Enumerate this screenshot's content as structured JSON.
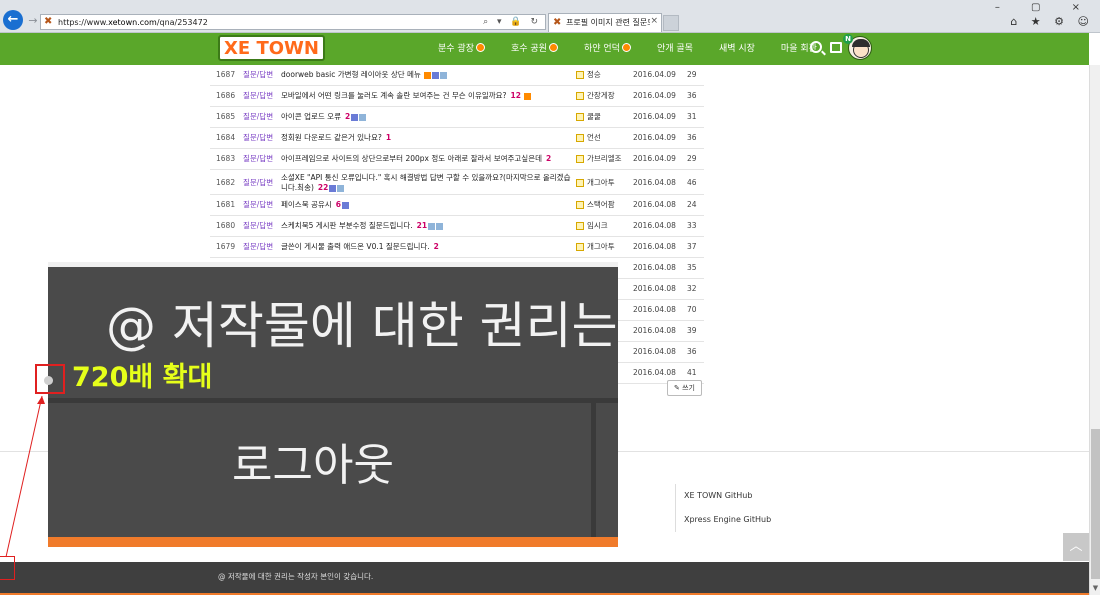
{
  "browser": {
    "url_prefix": "https://www.",
    "url_host": "xetown.com",
    "url_path": "/qna/253472",
    "url_controls": "⌕ ▾ 🔒 ↻",
    "tab_title": "프로필 이미지 관련 질문드...",
    "tab_close": "×",
    "back": "←",
    "forward": "→",
    "window_controls": "– ▢ ×",
    "toolbar_icons": "⌂ ★ ⚙ ☺",
    "site_icon": "✖"
  },
  "site": {
    "logo": "XE TOWN",
    "menu": [
      {
        "label": "분수 광장",
        "badge": true
      },
      {
        "label": "호수 공원",
        "badge": true
      },
      {
        "label": "하얀 언덕",
        "badge": true
      },
      {
        "label": "안개 골목",
        "badge": false
      },
      {
        "label": "새벽 시장",
        "badge": false
      },
      {
        "label": "마을 회관",
        "badge": false
      }
    ],
    "avatar_badge": "N"
  },
  "board": {
    "rows": [
      {
        "no": "1687",
        "cat": "질문/답변",
        "title": "doorweb basic 가변형 레이아웃 상단 메뉴",
        "comments": "",
        "icons": [
          "a",
          "b",
          "c"
        ],
        "author": "정승",
        "date": "2016.04.09",
        "views": "29"
      },
      {
        "no": "1686",
        "cat": "질문/답변",
        "title": "모바일에서 어떤 링크를 눌러도 계속 솔란 보여주는 건 무슨 이유일까요?",
        "comments": "12",
        "icons": [
          "a"
        ],
        "author": "간장게장",
        "date": "2016.04.09",
        "views": "36"
      },
      {
        "no": "1685",
        "cat": "질문/답변",
        "title": "아이콘 업로드 오류",
        "comments": "2",
        "icons": [
          "b",
          "c"
        ],
        "author": "쿨쿨",
        "date": "2016.04.09",
        "views": "31"
      },
      {
        "no": "1684",
        "cat": "질문/답변",
        "title": "정회원 다운로드 같은거 있나요?",
        "comments": "1",
        "icons": [],
        "author": "언선",
        "date": "2016.04.09",
        "views": "36"
      },
      {
        "no": "1683",
        "cat": "질문/답변",
        "title": "아이프레임으로 사이트의 상단으로부터 200px 정도 아래로 잘라서 보여주고싶은데",
        "comments": "2",
        "icons": [],
        "author": "가브리엘조",
        "date": "2016.04.09",
        "views": "29"
      },
      {
        "no": "1682",
        "cat": "질문/답변",
        "title": "소셜XE \"API 통신 오류입니다.\" 혹시 해결방법 답변 구할 수 있을까요?(마지막으로 올리겠습니다.최송)",
        "comments": "22",
        "icons": [
          "b",
          "c"
        ],
        "author": "개그아투",
        "date": "2016.04.08",
        "views": "46",
        "tall": true
      },
      {
        "no": "1681",
        "cat": "질문/답변",
        "title": "페이스북 공유시",
        "comments": "6",
        "icons": [
          "b"
        ],
        "author": "스택어팜",
        "date": "2016.04.08",
        "views": "24"
      },
      {
        "no": "1680",
        "cat": "질문/답변",
        "title": "스케치북5 게시판 부분수정 질문드립니다.",
        "comments": "21",
        "icons": [
          "c",
          "c"
        ],
        "author": "임시크",
        "date": "2016.04.08",
        "views": "33"
      },
      {
        "no": "1679",
        "cat": "질문/답변",
        "title": "글쓴이 게시물 출력 애드온 V0.1 질문드립니다.",
        "comments": "2",
        "icons": [],
        "author": "개그아투",
        "date": "2016.04.08",
        "views": "37"
      },
      {
        "no": "",
        "cat": "",
        "title": "",
        "comments": "",
        "icons": [],
        "author": "",
        "date": "2016.04.08",
        "views": "35"
      },
      {
        "no": "",
        "cat": "",
        "title": "",
        "comments": "",
        "icons": [],
        "author": "",
        "date": "2016.04.08",
        "views": "32"
      },
      {
        "no": "",
        "cat": "",
        "title": "",
        "comments": "",
        "icons": [],
        "author": "",
        "date": "2016.04.08",
        "views": "70"
      },
      {
        "no": "",
        "cat": "",
        "title": "",
        "comments": "",
        "icons": [],
        "author": "",
        "date": "2016.04.08",
        "views": "39"
      },
      {
        "no": "",
        "cat": "",
        "title": "",
        "comments": "",
        "icons": [],
        "author": "",
        "date": "2016.04.08",
        "views": "36"
      },
      {
        "no": "",
        "cat": "",
        "title": "",
        "comments": "",
        "icons": [],
        "author": "",
        "date": "2016.04.08",
        "views": "41"
      }
    ],
    "write_label": "✎ 쓰기"
  },
  "footer": {
    "links": [
      "XE TOWN GitHub",
      "Xpress Engine GitHub"
    ],
    "copyright": "@ 저작물에 대한 권리는 작성자 본인이 갖습니다.",
    "back_to_top": "︿"
  },
  "zoom": {
    "text": "@ 저작물에 대한 권리는 작",
    "logout": "로그아웃",
    "label": "720배 확대"
  },
  "colors": {
    "header_green": "#5aa72a",
    "accent_orange": "#f07b2b",
    "zoom_label": "#e6ff1a",
    "highlight_red": "#e02020"
  }
}
